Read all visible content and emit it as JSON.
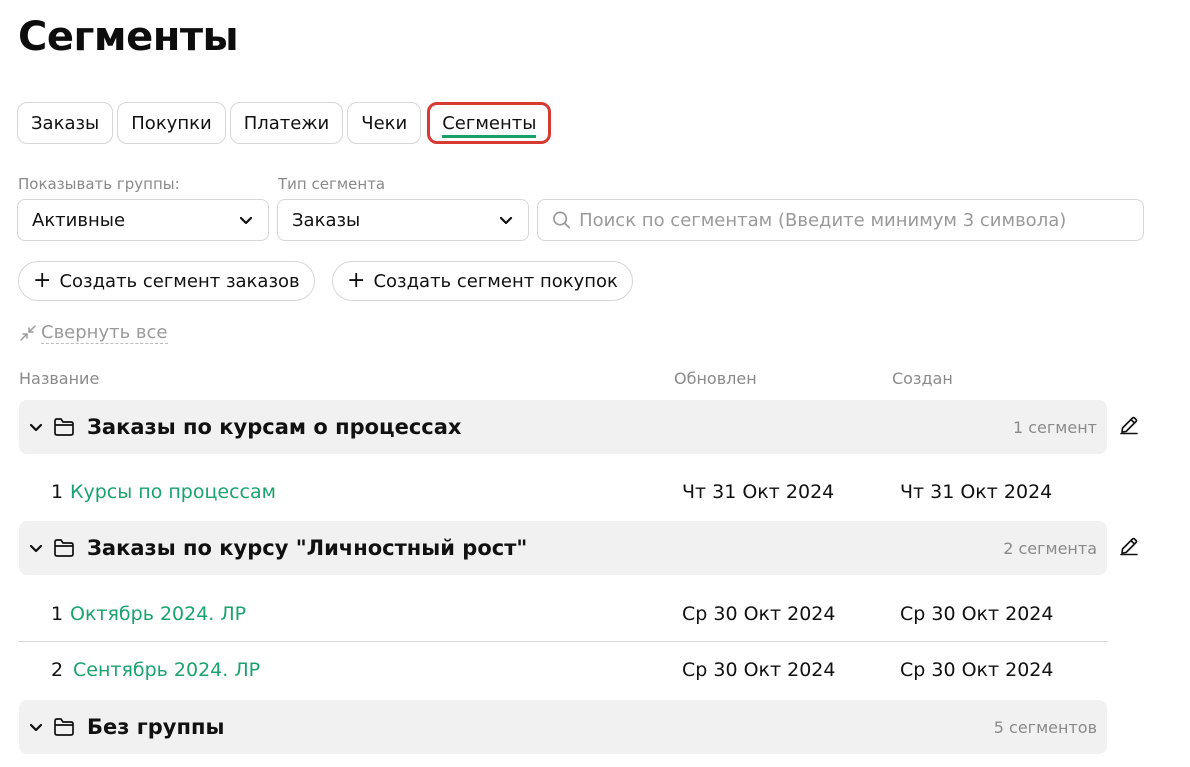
{
  "page": {
    "title": "Сегменты"
  },
  "tabs": [
    {
      "label": "Заказы"
    },
    {
      "label": "Покупки"
    },
    {
      "label": "Платежи"
    },
    {
      "label": "Чеки"
    },
    {
      "label": "Сегменты"
    }
  ],
  "filters": {
    "groups_label": "Показывать группы:",
    "groups_value": "Активные",
    "type_label": "Тип сегмента",
    "type_value": "Заказы",
    "search_placeholder": "Поиск по сегментам (Введите минимум 3 символа)"
  },
  "actions": {
    "create_orders": "Создать сегмент заказов",
    "create_purchases": "Создать сегмент покупок",
    "collapse_all": "Свернуть все"
  },
  "columns": {
    "name": "Название",
    "updated": "Обновлен",
    "created": "Создан"
  },
  "groups": [
    {
      "title": "Заказы по курсам о процессах",
      "count": "1 сегмент",
      "rows": [
        {
          "num": "1",
          "name": "Курсы по процессам",
          "updated": "Чт 31 Окт 2024",
          "created": "Чт 31 Окт 2024"
        }
      ]
    },
    {
      "title": "Заказы по курсу \"Личностный рост\"",
      "count": "2 сегмента",
      "rows": [
        {
          "num": "1",
          "name": "Октябрь 2024. ЛР",
          "updated": "Ср 30 Окт 2024",
          "created": "Ср 30 Окт 2024"
        },
        {
          "num": "2",
          "name": "Сентябрь 2024. ЛР",
          "updated": "Ср 30 Окт 2024",
          "created": "Ср 30 Окт 2024"
        }
      ]
    },
    {
      "title": "Без группы",
      "count": "5 сегментов",
      "rows": []
    }
  ],
  "colors": {
    "accent_green": "#1aa36e",
    "highlight_red": "#d63a32",
    "group_bg": "#f1f1f1"
  },
  "icons": [
    "chevron-down-icon",
    "search-icon",
    "plus-icon",
    "collapse-icon",
    "folder-icon",
    "pencil-icon"
  ]
}
